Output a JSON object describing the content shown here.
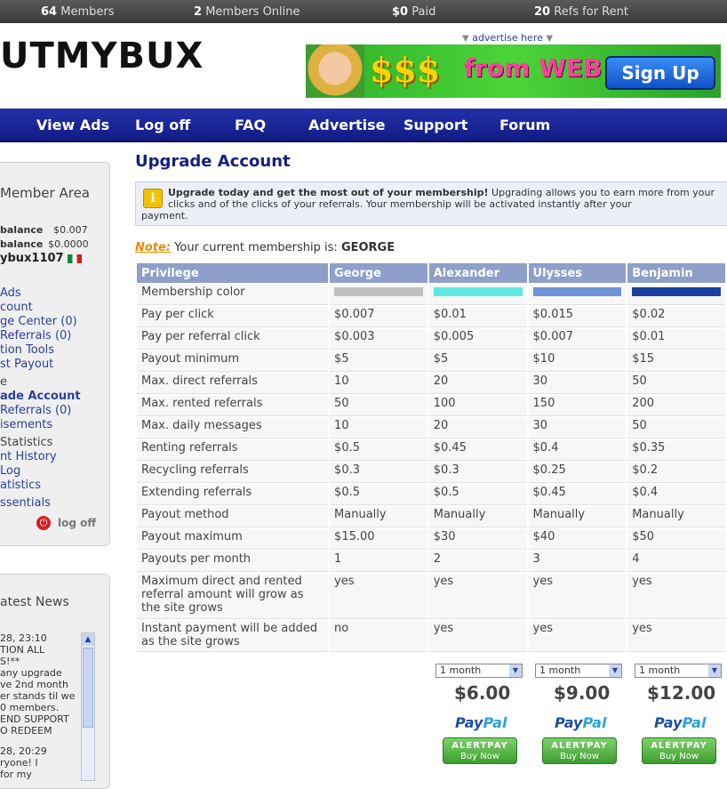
{
  "statbar": {
    "members_count": "64",
    "members_label": "Members",
    "online_count": "2",
    "online_label": "Members Online",
    "paid_value": "$0",
    "paid_label": "Paid",
    "refs_count": "20",
    "refs_label": "Refs for Rent"
  },
  "header": {
    "logo": "UTMYBUX",
    "advertise_link": "advertise here",
    "banner": {
      "dollars": "$$$",
      "from_web": "from WEB",
      "signup": "Sign Up"
    }
  },
  "nav": [
    "View Ads",
    "Log off",
    "FAQ",
    "Advertise",
    "Support",
    "Forum"
  ],
  "sidebar": {
    "member_area_title": "Member Area",
    "balance_label": "balance",
    "balance_value": "$0.007",
    "rental_balance_label": "balance",
    "rental_balance_value": "$0.0000",
    "username": "ybux1107",
    "links": [
      "Ads",
      "count",
      "ge Center (0)",
      "Referrals (0)",
      "tion Tools",
      "st Payout",
      "e",
      "ade Account",
      "Referrals (0)",
      "isements",
      "Statistics",
      "nt History",
      "Log",
      "atistics",
      "ssentials"
    ],
    "logoff": "log off",
    "news_title": "atest News",
    "news_lines": [
      "28, 23:10",
      "TION ALL",
      "S!**",
      "any upgrade",
      "ve 2nd month",
      "er stands til we",
      "0 members.",
      "END SUPPORT",
      "O REDEEM",
      "28, 20:29",
      "ryone! I",
      "for my"
    ]
  },
  "main": {
    "title": "Upgrade Account",
    "info_bold": "Upgrade today and get the most out of your membership!",
    "info_text": "Upgrading allows you to earn more from your clicks and of the clicks of your referrals. Your membership will be activated instantly after your",
    "info_last": "payment.",
    "note_label": "Note:",
    "note_text": "Your current membership is:",
    "note_value": "GEORGE",
    "table": {
      "headers": [
        "Privilege",
        "George",
        "Alexander",
        "Ulysses",
        "Benjamin"
      ],
      "swatches": [
        "#c0c0c0",
        "#5fe8e0",
        "#6f95d8",
        "#1a3fa0"
      ],
      "rows": [
        [
          "Membership color",
          "",
          "",
          "",
          ""
        ],
        [
          "Pay per click",
          "$0.007",
          "$0.01",
          "$0.015",
          "$0.02"
        ],
        [
          "Pay per referral click",
          "$0.003",
          "$0.005",
          "$0.007",
          "$0.01"
        ],
        [
          "Payout minimum",
          "$5",
          "$5",
          "$10",
          "$15"
        ],
        [
          "Max. direct referrals",
          "10",
          "20",
          "30",
          "50"
        ],
        [
          "Max. rented referrals",
          "50",
          "100",
          "150",
          "200"
        ],
        [
          "Max. daily messages",
          "10",
          "20",
          "30",
          "50"
        ],
        [
          "Renting referrals",
          "$0.5",
          "$0.45",
          "$0.4",
          "$0.35"
        ],
        [
          "Recycling referrals",
          "$0.3",
          "$0.3",
          "$0.25",
          "$0.2"
        ],
        [
          "Extending referrals",
          "$0.5",
          "$0.5",
          "$0.45",
          "$0.4"
        ],
        [
          "Payout method",
          "Manually",
          "Manually",
          "Manually",
          "Manually"
        ],
        [
          "Payout maximum",
          "$15.00",
          "$30",
          "$40",
          "$50"
        ],
        [
          "Payouts per month",
          "1",
          "2",
          "3",
          "4"
        ],
        [
          "Maximum direct and rented referral amount will grow as the site grows",
          "yes",
          "yes",
          "yes",
          "yes"
        ],
        [
          "Instant payment will be added as the site grows",
          "no",
          "yes",
          "yes",
          "yes"
        ]
      ]
    },
    "plans": [
      {
        "duration": "1 month",
        "price": "$6.00"
      },
      {
        "duration": "1 month",
        "price": "$9.00"
      },
      {
        "duration": "1 month",
        "price": "$12.00"
      }
    ],
    "paypal_pay": "Pay",
    "paypal_pal": "Pal",
    "alertpay_label": "ALERTPAY",
    "buy_now": "Buy Now"
  }
}
